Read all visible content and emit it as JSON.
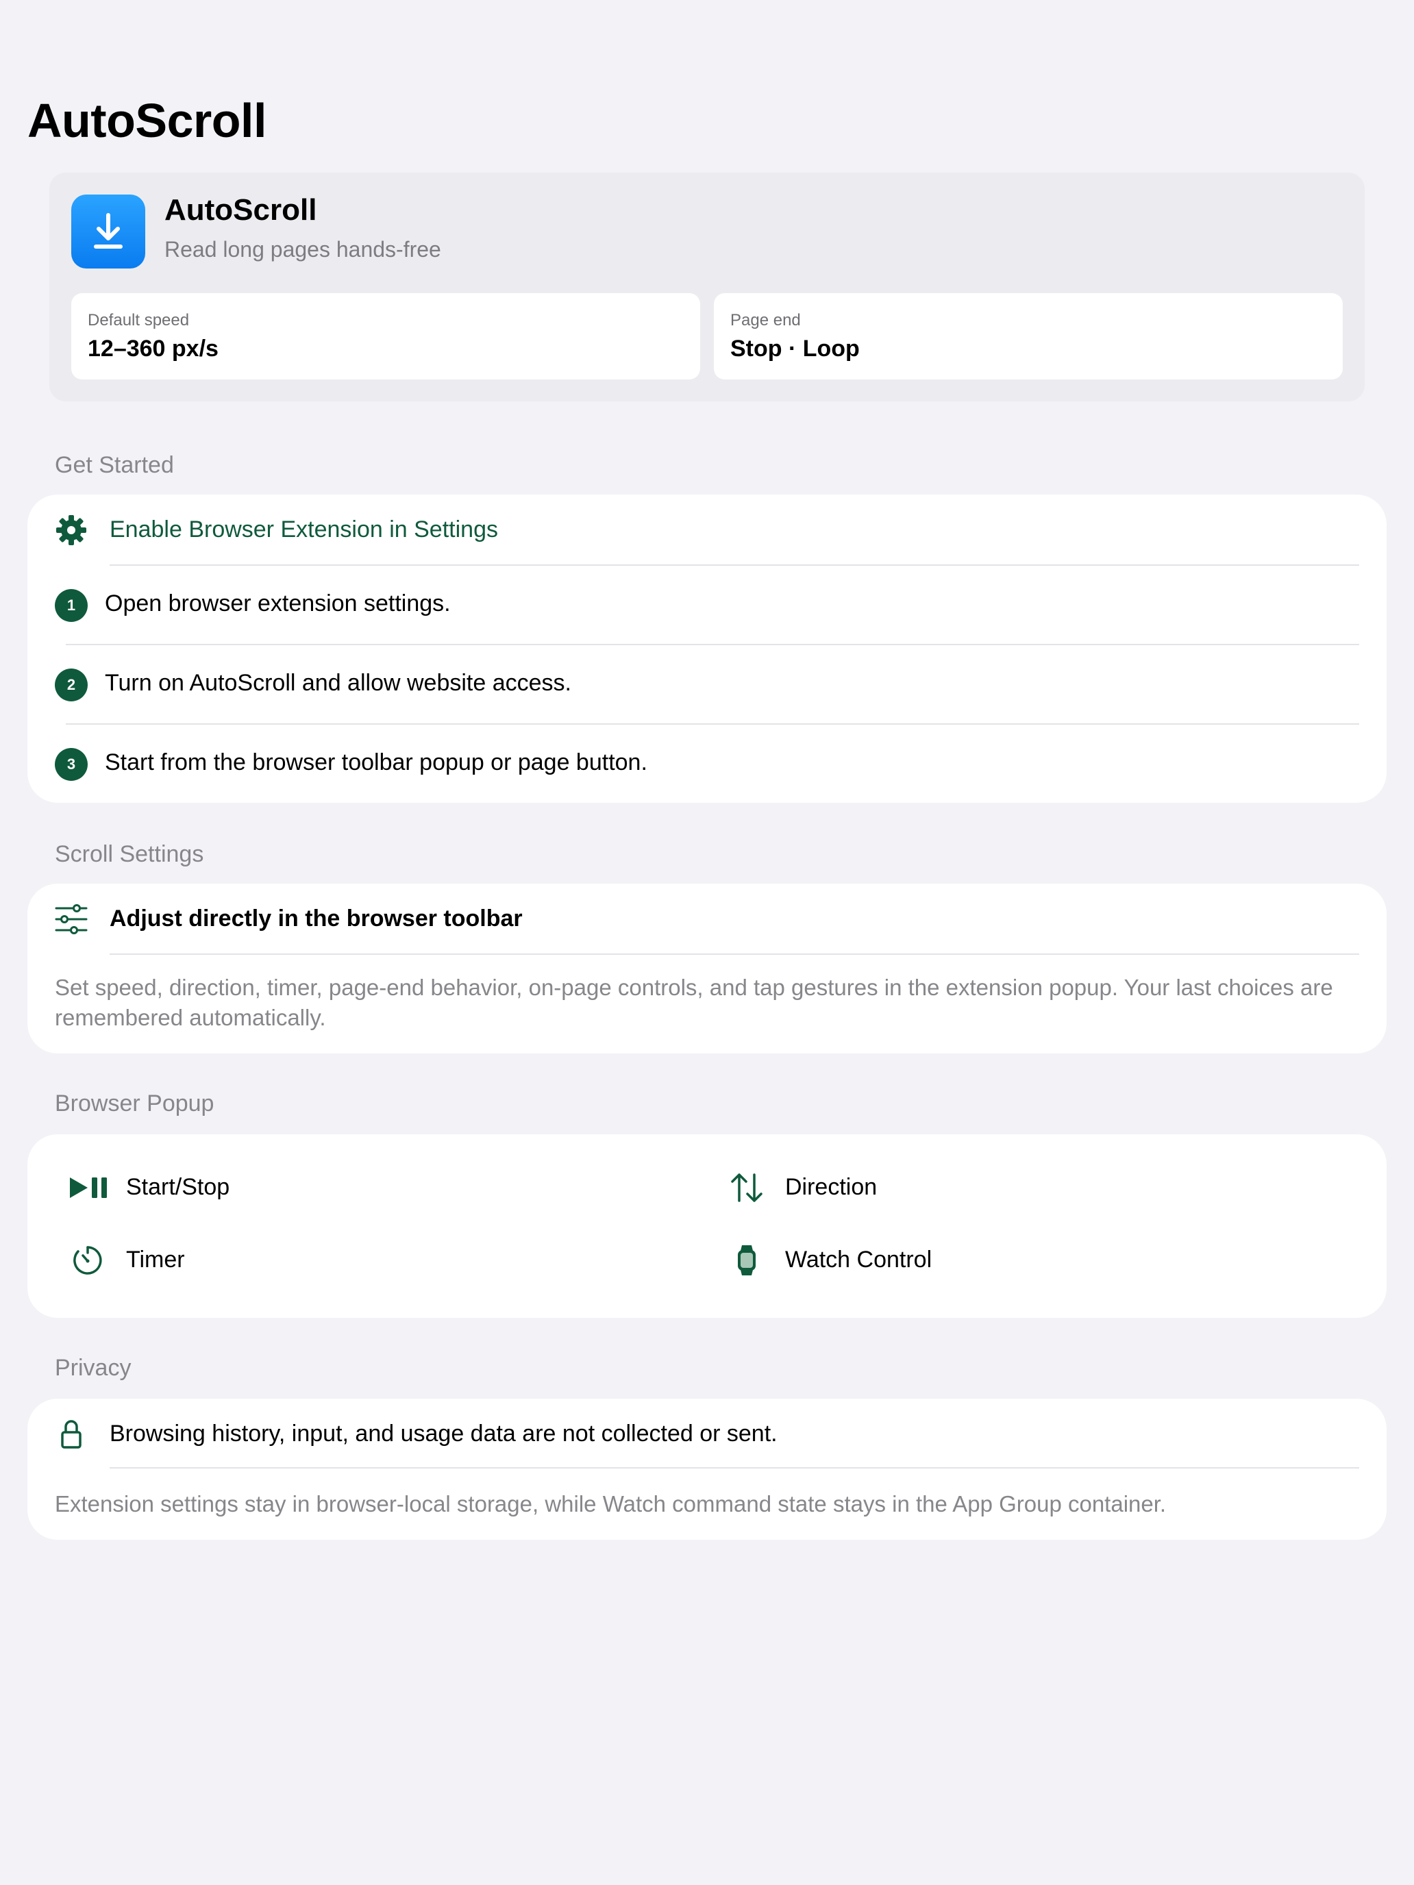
{
  "nav": {
    "title": "AutoScroll"
  },
  "hero": {
    "app_name": "AutoScroll",
    "tagline": "Read long pages hands-free",
    "stats": [
      {
        "label": "Default speed",
        "value": "12–360 px/s"
      },
      {
        "label": "Page end",
        "value": "Stop · Loop"
      }
    ]
  },
  "get_started": {
    "header": "Get Started",
    "action": "Enable Browser Extension in Settings",
    "steps": [
      {
        "number": "1",
        "text": "Open browser extension settings."
      },
      {
        "number": "2",
        "text": "Turn on AutoScroll and allow website access."
      },
      {
        "number": "3",
        "text": "Start from the browser toolbar popup or page button."
      }
    ]
  },
  "scroll_settings": {
    "header": "Scroll Settings",
    "title": "Adjust directly in the browser toolbar",
    "description": "Set speed, direction, timer, page-end behavior, on-page controls, and tap gestures in the extension popup. Your last choices are remembered automatically."
  },
  "browser_popup": {
    "header": "Browser Popup",
    "items": [
      {
        "label": "Start/Stop",
        "icon": "play-pause-icon"
      },
      {
        "label": "Direction",
        "icon": "arrows-up-down-icon"
      },
      {
        "label": "Timer",
        "icon": "timer-icon"
      },
      {
        "label": "Watch Control",
        "icon": "watch-icon"
      }
    ]
  },
  "privacy": {
    "header": "Privacy",
    "statement": "Browsing history, input, and usage data are not collected or sent.",
    "detail": "Extension settings stay in browser-local storage, while Watch command state stays in the App Group container."
  },
  "colors": {
    "background": "#f2f2f7",
    "accent_green": "#0f5a3c",
    "app_icon_blue": "#1a8cf7",
    "secondary_text": "#86868b"
  }
}
